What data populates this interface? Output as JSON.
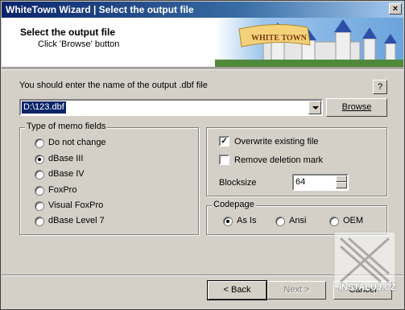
{
  "window": {
    "title": "WhiteTown Wizard | Select the output file",
    "close_label": "×"
  },
  "header": {
    "title": "Select the output file",
    "subtitle": "Click 'Browse' button",
    "banner_text": "WHITE TOWN"
  },
  "output": {
    "prompt": "You should enter the name of the output .dbf file",
    "help_label": "?",
    "path_value": "D:\\123.dbf",
    "browse_label": "Browse"
  },
  "memo_group": {
    "title": "Type of memo fields",
    "options": [
      {
        "label": "Do not change",
        "selected": false
      },
      {
        "label": "dBase III",
        "selected": true
      },
      {
        "label": "dBase IV",
        "selected": false
      },
      {
        "label": "FoxPro",
        "selected": false
      },
      {
        "label": "Visual FoxPro",
        "selected": false
      },
      {
        "label": "dBase Level 7",
        "selected": false
      }
    ]
  },
  "options_group": {
    "overwrite_label": "Overwrite existing file",
    "overwrite_checked": true,
    "remove_label": "Remove deletion mark",
    "remove_checked": false,
    "blocksize_label": "Blocksize",
    "blocksize_value": "64"
  },
  "codepage_group": {
    "title": "Codepage",
    "options": [
      {
        "label": "As Is",
        "selected": true
      },
      {
        "label": "Ansi",
        "selected": false
      },
      {
        "label": "OEM",
        "selected": false
      }
    ]
  },
  "footer": {
    "back_label": "< Back",
    "next_label": "Next >",
    "cancel_label": "Cancel"
  },
  "watermark": {
    "text": "INSTALUJ.CZ"
  }
}
